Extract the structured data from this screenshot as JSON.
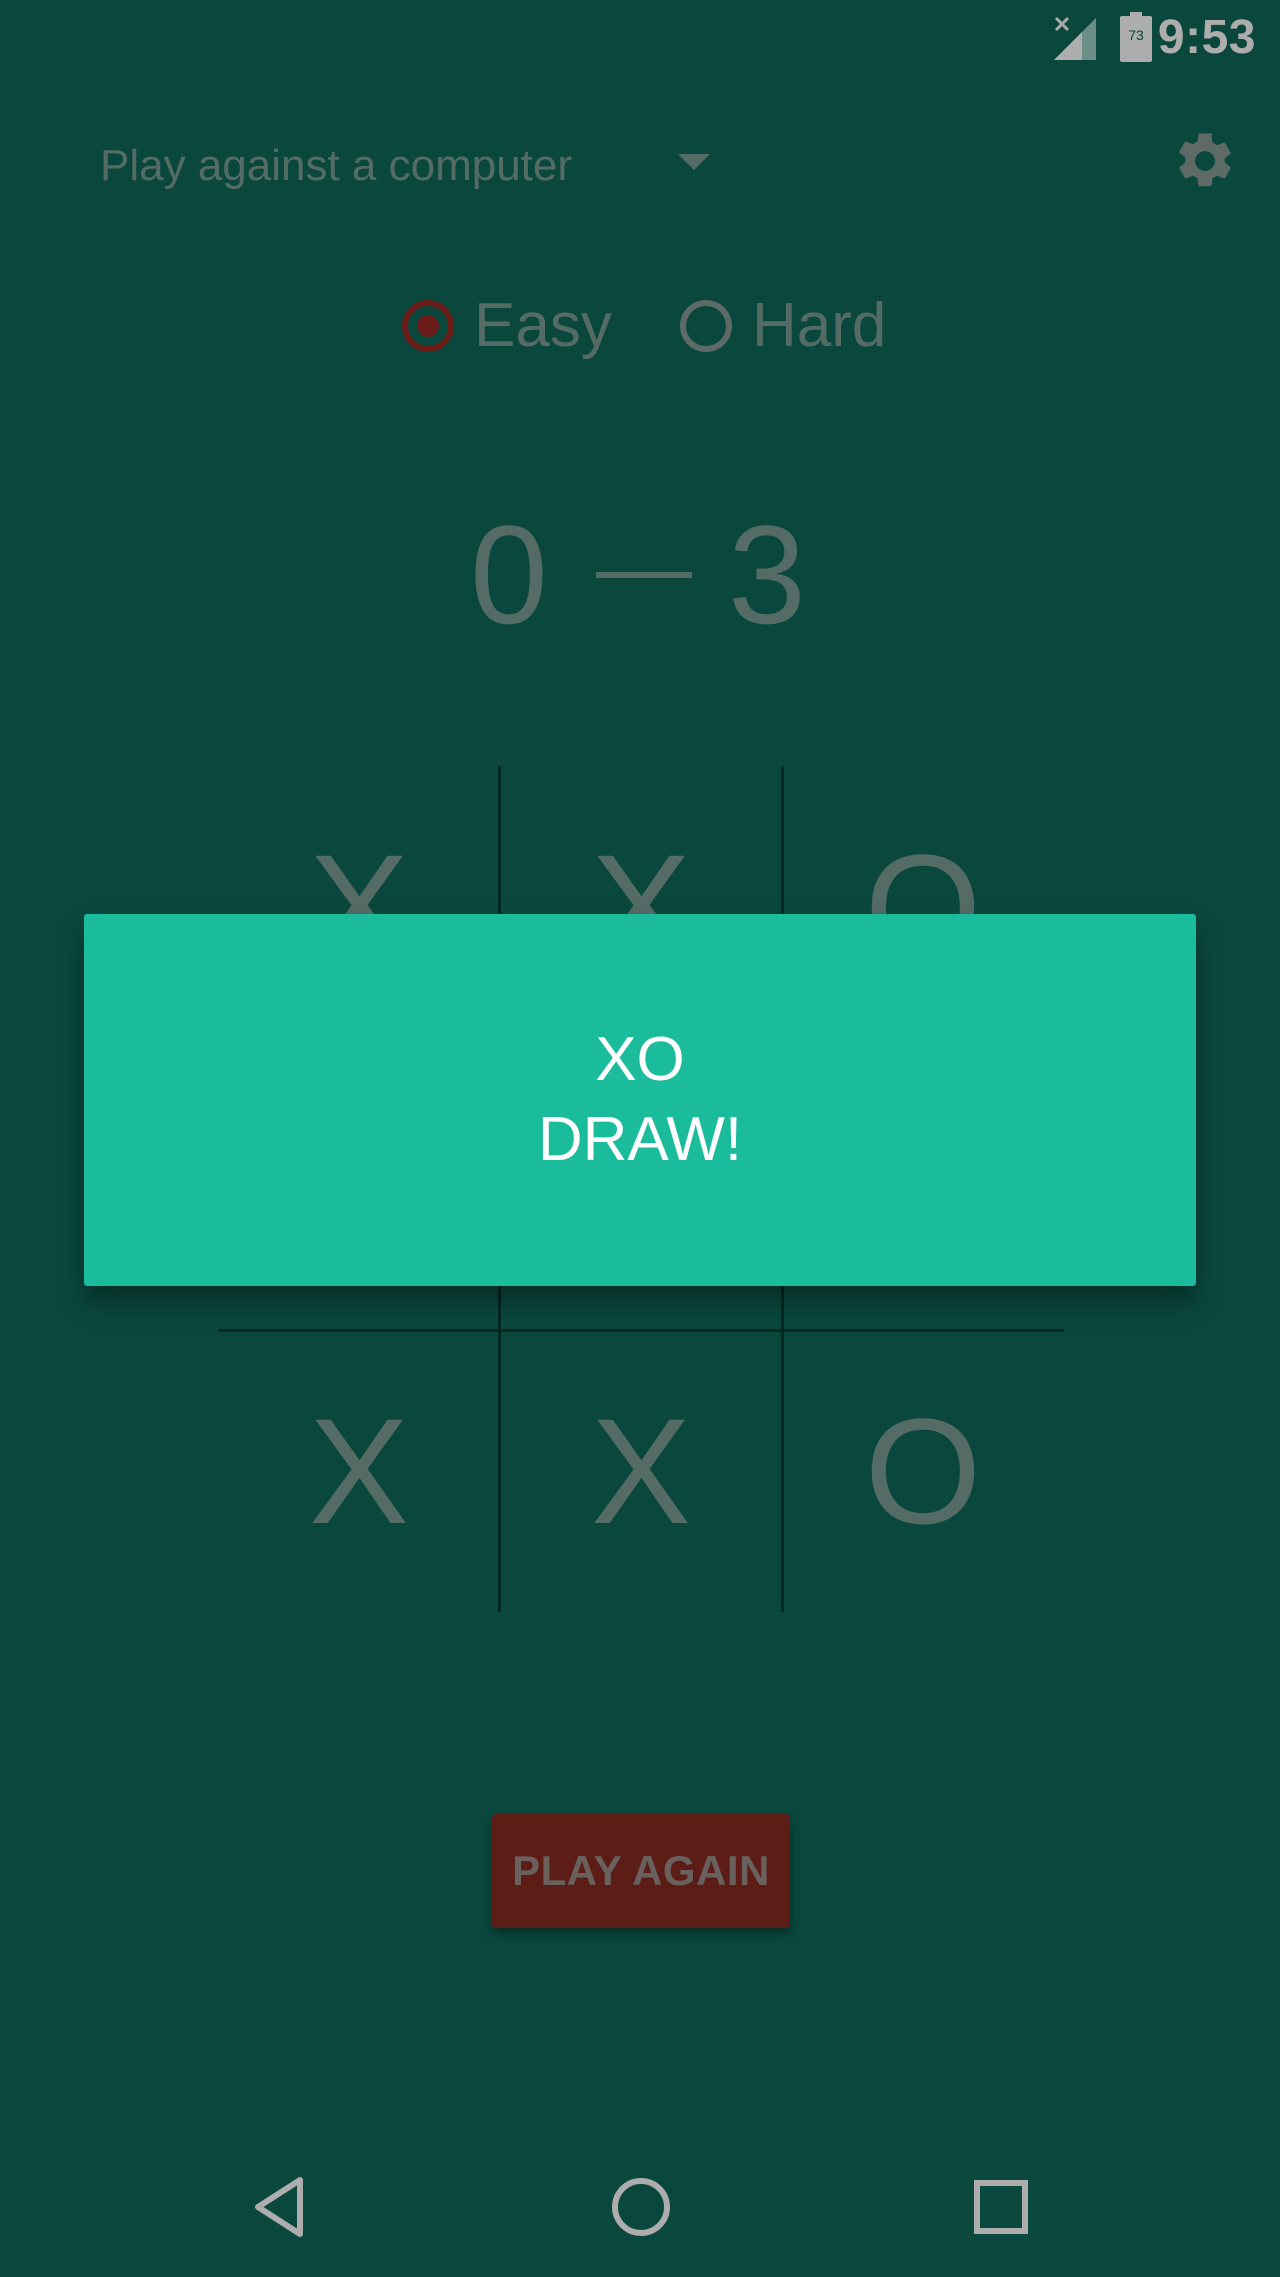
{
  "status_bar": {
    "time": "9:53",
    "battery_level": "73",
    "signal_icon": "signal-no-service-icon",
    "battery_icon": "battery-icon"
  },
  "toolbar": {
    "mode_label": "Play against a computer",
    "settings_icon": "gear-icon"
  },
  "difficulty": {
    "options": [
      {
        "label": "Easy",
        "selected": true
      },
      {
        "label": "Hard",
        "selected": false
      }
    ]
  },
  "score": {
    "left": "0",
    "right": "3"
  },
  "board": {
    "cells": [
      "X",
      "X",
      "O",
      "",
      "",
      "",
      "X",
      "X",
      "O"
    ]
  },
  "result_card": {
    "line1": "XO",
    "line2": "DRAW!"
  },
  "actions": {
    "play_again_label": "PLAY AGAIN"
  },
  "colors": {
    "background": "#0f6a5b",
    "card": "#1bbc9b",
    "accent_red": "#9b2a24",
    "text_dim": "#7e9e96"
  }
}
